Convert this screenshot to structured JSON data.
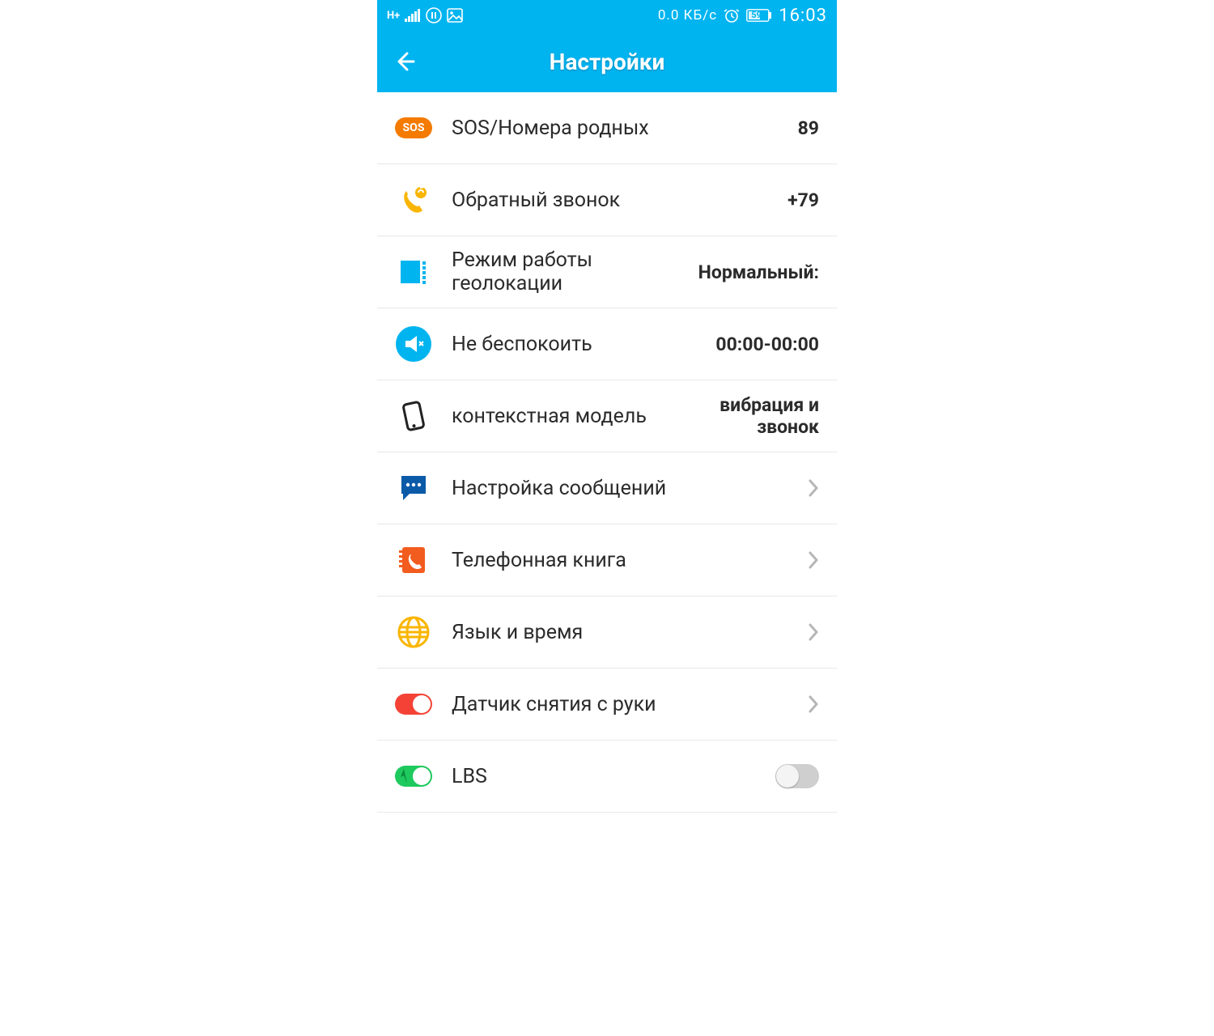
{
  "status": {
    "network_badge": "H+",
    "data_rate": "0.0 КБ/с",
    "battery_text": "59",
    "clock": "16:03"
  },
  "header": {
    "title": "Настройки"
  },
  "rows": {
    "sos": {
      "label": "SOS/Номера родных",
      "value": "89"
    },
    "callback": {
      "label": "Обратный звонок",
      "value": "+79"
    },
    "geomode": {
      "label": "Режим работы геолокации",
      "value": "Нормальный:"
    },
    "dnd": {
      "label": "Не беспокоить",
      "value": "00:00-00:00"
    },
    "profile": {
      "label": "контекстная модель",
      "value": "вибрация и звонок"
    },
    "messages": {
      "label": "Настройка сообщений"
    },
    "phonebook": {
      "label": "Телефонная книга"
    },
    "lang_time": {
      "label": "Язык и время"
    },
    "takeoff": {
      "label": "Датчик снятия с руки"
    },
    "lbs": {
      "label": "LBS",
      "toggle": false
    }
  },
  "icons": {
    "sos_text": "SOS"
  }
}
